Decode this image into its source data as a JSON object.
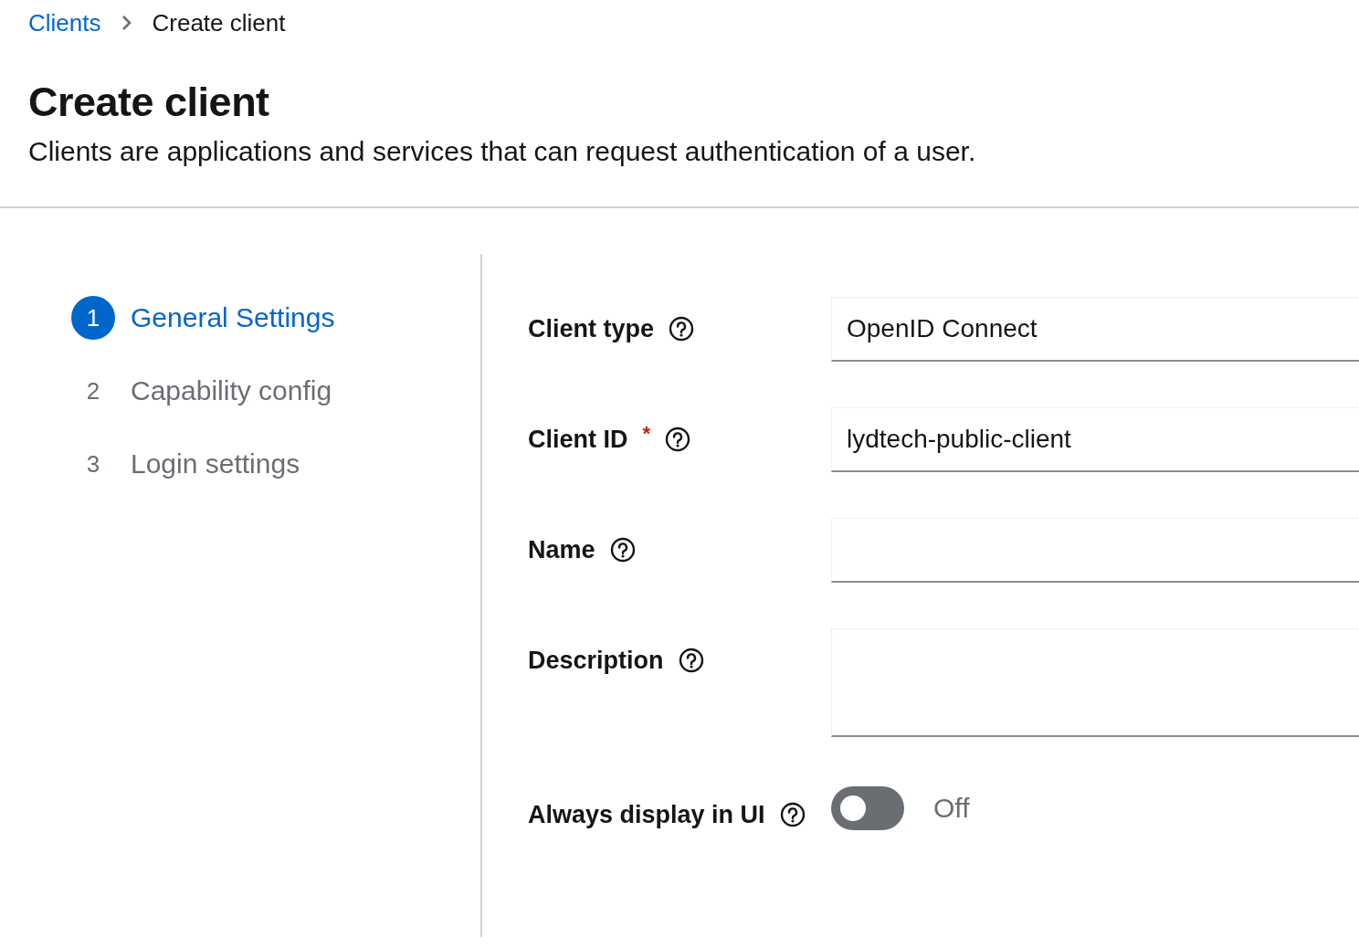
{
  "breadcrumb": [
    {
      "label": "Clients",
      "link": true
    },
    {
      "label": "Create client",
      "link": false
    }
  ],
  "header": {
    "title": "Create client",
    "description": "Clients are applications and services that can request authentication of a user."
  },
  "steps": [
    {
      "number": "1",
      "label": "General Settings",
      "selected": true
    },
    {
      "number": "2",
      "label": "Capability config",
      "selected": false
    },
    {
      "number": "3",
      "label": "Login settings",
      "selected": false
    }
  ],
  "fields": [
    {
      "kind": "text",
      "label": "Client type",
      "value": "OpenID Connect"
    },
    {
      "kind": "text",
      "label": "Client ID",
      "required_mark": "*",
      "value": "lydtech-public-client"
    },
    {
      "kind": "text",
      "label": "Name"
    },
    {
      "kind": "textarea",
      "label": "Description"
    },
    {
      "kind": "switch",
      "label": "Always display in UI",
      "on": false,
      "state_label": "Off"
    }
  ]
}
